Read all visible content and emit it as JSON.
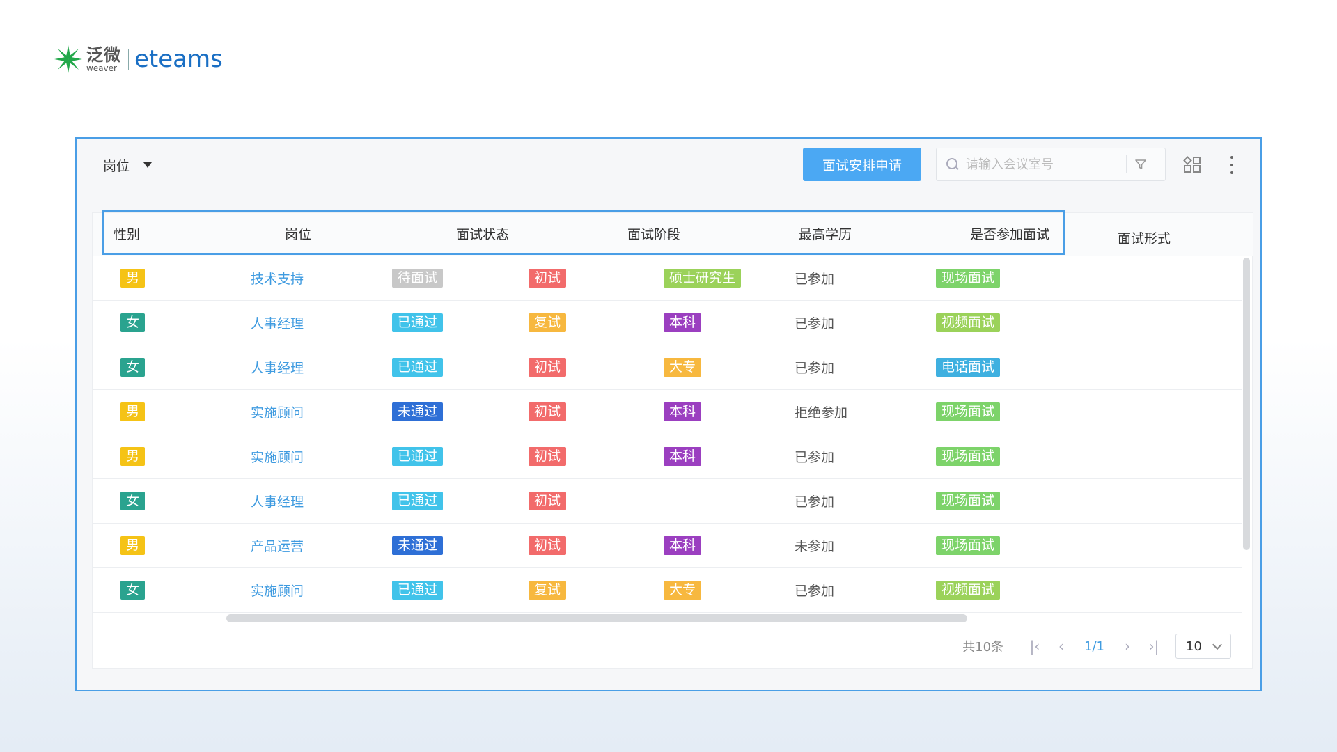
{
  "brand": {
    "cn_name": "泛微",
    "cn_sub": "weaver",
    "en_name": "eteams",
    "colors": {
      "mark": "#22a84a",
      "en": "#1a6fc4"
    }
  },
  "toolbar": {
    "post_filter_label": "岗位",
    "primary_button_label": "面试安排申请",
    "search_placeholder": "请输入会议室号",
    "icons": [
      "chevron-down-icon",
      "search-icon",
      "filter-icon",
      "grid-icon",
      "more-vertical-icon"
    ]
  },
  "table": {
    "columns": [
      "性别",
      "岗位",
      "面试状态",
      "面试阶段",
      "最高学历",
      "是否参加面试",
      "面试形式"
    ],
    "rows": [
      {
        "gender": "男",
        "post": "技术支持",
        "status": "待面试",
        "stage": "初试",
        "edu": "硕士研究生",
        "attend": "已参加",
        "form": "现场面试"
      },
      {
        "gender": "女",
        "post": "人事经理",
        "status": "已通过",
        "stage": "复试",
        "edu": "本科",
        "attend": "已参加",
        "form": "视频面试"
      },
      {
        "gender": "女",
        "post": "人事经理",
        "status": "已通过",
        "stage": "初试",
        "edu": "大专",
        "attend": "已参加",
        "form": "电话面试"
      },
      {
        "gender": "男",
        "post": "实施顾问",
        "status": "未通过",
        "stage": "初试",
        "edu": "本科",
        "attend": "拒绝参加",
        "form": "现场面试"
      },
      {
        "gender": "男",
        "post": "实施顾问",
        "status": "已通过",
        "stage": "初试",
        "edu": "本科",
        "attend": "已参加",
        "form": "现场面试"
      },
      {
        "gender": "女",
        "post": "人事经理",
        "status": "已通过",
        "stage": "初试",
        "edu": "",
        "attend": "已参加",
        "form": "现场面试"
      },
      {
        "gender": "男",
        "post": "产品运营",
        "status": "未通过",
        "stage": "初试",
        "edu": "本科",
        "attend": "未参加",
        "form": "现场面试"
      },
      {
        "gender": "女",
        "post": "实施顾问",
        "status": "已通过",
        "stage": "复试",
        "edu": "大专",
        "attend": "已参加",
        "form": "视频面试"
      }
    ]
  },
  "tag_colors": {
    "男": "#f5c316",
    "女": "#2aa38f",
    "待面试": "#c8c8c8",
    "已通过": "#41c3ea",
    "未通过": "#2e6fd6",
    "初试": "#f26b6b",
    "复试": "#f7b83f",
    "硕士研究生": "#9bd25a",
    "本科": "#9b3fc0",
    "大专": "#f7b83f",
    "现场面试": "#7dd36a",
    "视频面试": "#9bd25a",
    "电话面试": "#3fb0e0"
  },
  "pagination": {
    "total_label": "共10条",
    "current": "1/1",
    "page_size": "10",
    "icons": [
      "first-page-icon",
      "prev-page-icon",
      "next-page-icon",
      "last-page-icon",
      "chevron-down-icon"
    ]
  }
}
